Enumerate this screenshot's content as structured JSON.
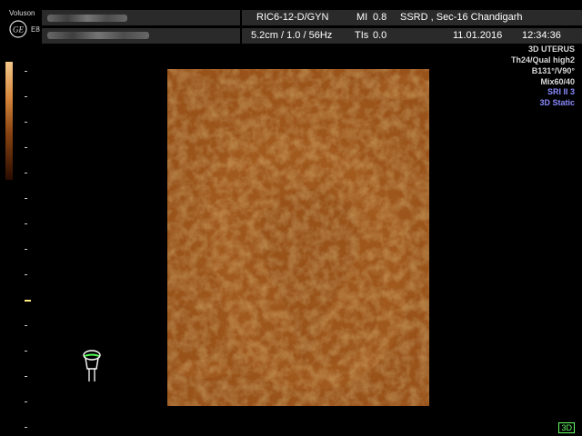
{
  "header": {
    "brand": "Voluson",
    "brand_sub": "E8",
    "probe_mode": "RIC6-12-D/GYN",
    "mi_label": "MI",
    "mi_value": "0.8",
    "facility": "SSRD , Sec-16 Chandigarh",
    "depth_freq": "5.2cm / 1.0 / 56Hz",
    "tis_label": "TIs",
    "tis_value": "0.0",
    "date": "11.01.2016",
    "time": "12:34:36"
  },
  "info_panel": {
    "lines_grey": [
      "3D UTERUS",
      "Th24/Qual high2",
      "B131°/V90°",
      "Mix60/40"
    ],
    "lines_blue": [
      "SRI II 3",
      "3D Static"
    ]
  },
  "footer": {
    "mode_badge": "3D"
  },
  "icons": [
    "ge-logo-icon",
    "probe-icon"
  ],
  "colors": {
    "accent_blue": "#8a8aff",
    "image_tint": "#a0581c",
    "badge_green": "#66ff66"
  }
}
